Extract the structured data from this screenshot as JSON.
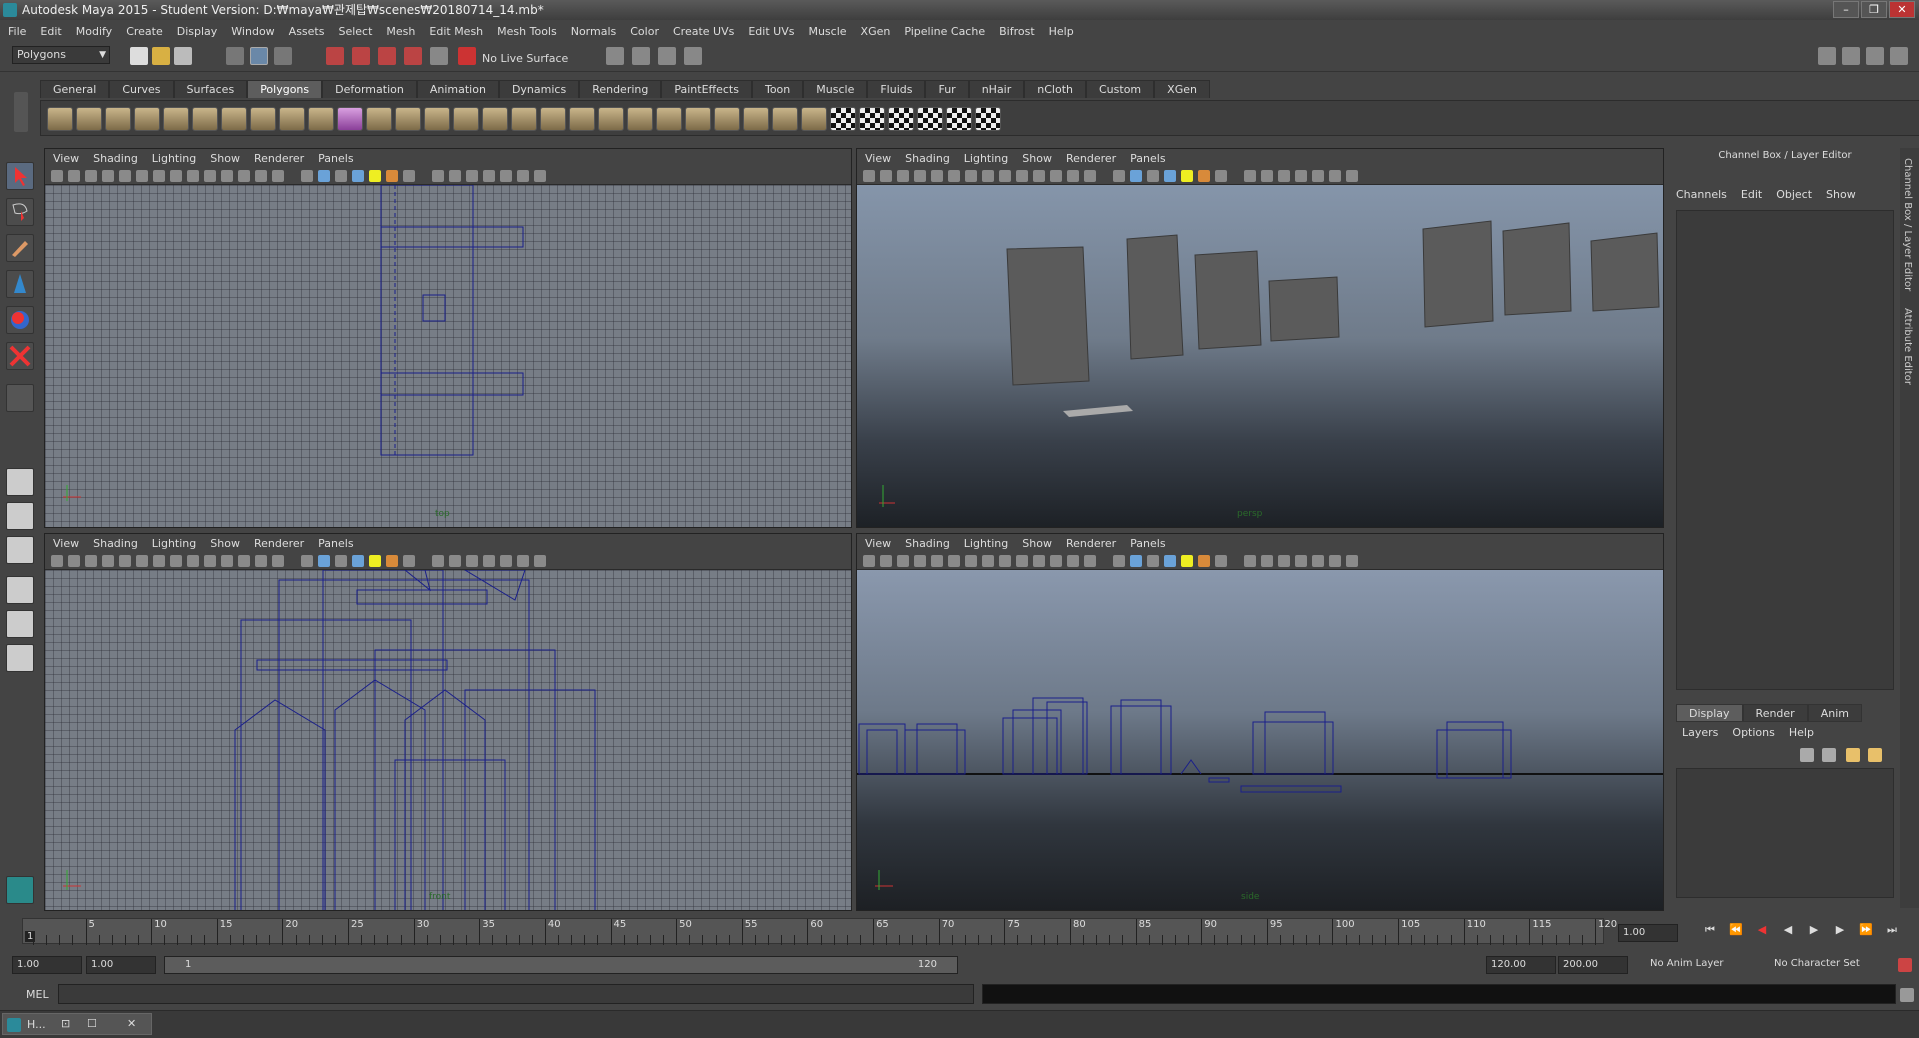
{
  "window": {
    "title": "Autodesk Maya 2015 - Student Version: D:₩maya₩관제탑₩scenes₩20180714_14.mb*",
    "minimize": "–",
    "restore": "❐",
    "close": "✕"
  },
  "menubar": [
    "File",
    "Edit",
    "Modify",
    "Create",
    "Display",
    "Window",
    "Assets",
    "Select",
    "Mesh",
    "Edit Mesh",
    "Mesh Tools",
    "Normals",
    "Color",
    "Create UVs",
    "Edit UVs",
    "Muscle",
    "XGen",
    "Pipeline Cache",
    "Bifrost",
    "Help"
  ],
  "status": {
    "mode": "Polygons",
    "live_surface": "No Live Surface"
  },
  "shelf": {
    "tabs": [
      "General",
      "Curves",
      "Surfaces",
      "Polygons",
      "Deformation",
      "Animation",
      "Dynamics",
      "Rendering",
      "PaintEffects",
      "Toon",
      "Muscle",
      "Fluids",
      "Fur",
      "nHair",
      "nCloth",
      "Custom",
      "XGen"
    ],
    "active": "Polygons"
  },
  "viewport_menu": [
    "View",
    "Shading",
    "Lighting",
    "Show",
    "Renderer",
    "Panels"
  ],
  "viewports": {
    "top_left_label": "top",
    "top_right_label": "persp",
    "bottom_left_label": "front",
    "bottom_right_label": "side"
  },
  "right_panel": {
    "title": "Channel Box / Layer Editor",
    "menu": [
      "Channels",
      "Edit",
      "Object",
      "Show"
    ],
    "layer_tabs": [
      "Display",
      "Render",
      "Anim"
    ],
    "layer_menu": [
      "Layers",
      "Options",
      "Help"
    ]
  },
  "side_tabs": {
    "channel_box": "Channel Box / Layer Editor",
    "attribute_editor": "Attribute Editor"
  },
  "timeline": {
    "ticks": [
      "5",
      "10",
      "15",
      "20",
      "25",
      "30",
      "35",
      "40",
      "45",
      "50",
      "55",
      "60",
      "65",
      "70",
      "75",
      "80",
      "85",
      "90",
      "95",
      "100",
      "105",
      "110",
      "115",
      "120"
    ],
    "current_frame": "1",
    "current_field": "1.00"
  },
  "range": {
    "start": "1.00",
    "start_inner": "1.00",
    "slider_start": "1",
    "slider_end": "120",
    "end_inner": "120.00",
    "end": "200.00",
    "anim_layer": "No Anim Layer",
    "character_set": "No Character Set"
  },
  "cmd": {
    "label": "MEL"
  },
  "taskbar": {
    "item": "H..."
  }
}
